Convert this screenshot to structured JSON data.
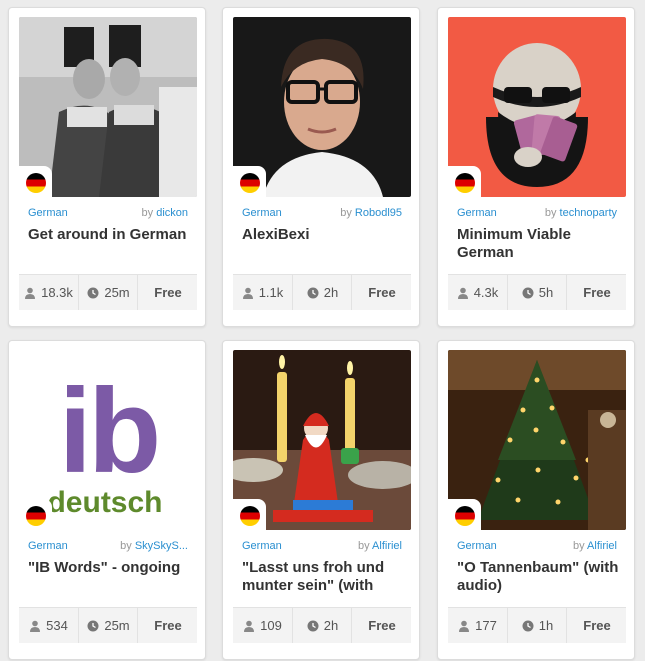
{
  "cards": [
    {
      "language": "German",
      "by_prefix": "by",
      "author": "dickon",
      "title": "Get around in German",
      "learners": "18.3k",
      "duration": "25m",
      "price": "Free",
      "image": "woman-pair-photo"
    },
    {
      "language": "German",
      "by_prefix": "by",
      "author": "Robodl95",
      "title": "AlexiBexi",
      "learners": "1.1k",
      "duration": "2h",
      "price": "Free",
      "image": "man-glasses-photo"
    },
    {
      "language": "German",
      "by_prefix": "by",
      "author": "technoparty",
      "title": "Minimum Viable German",
      "learners": "4.3k",
      "duration": "5h",
      "price": "Free",
      "image": "cartoon-cards-avatar"
    },
    {
      "language": "German",
      "by_prefix": "by",
      "author": "SkySkyS...",
      "title": "\"IB Words\" - ongoing",
      "learners": "534",
      "duration": "25m",
      "price": "Free",
      "image": "ib-deutsch-logo",
      "image_text": [
        "ib",
        "deutsch"
      ]
    },
    {
      "language": "German",
      "by_prefix": "by",
      "author": "Alfiriel",
      "title": "\"Lasst uns froh und munter sein\" (with",
      "learners": "109",
      "duration": "2h",
      "price": "Free",
      "image": "candles-santa-photo"
    },
    {
      "language": "German",
      "by_prefix": "by",
      "author": "Alfiriel",
      "title": "\"O Tannenbaum\" (with audio)",
      "learners": "177",
      "duration": "1h",
      "price": "Free",
      "image": "christmas-tree-photo"
    }
  ],
  "colors": {
    "link": "#2a8fd0",
    "card_bg": "#ffffff",
    "page_bg": "#ececec",
    "cartoon_bg": "#f25a44",
    "ib_purple": "#7c5aa6",
    "ib_green": "#5e8a2c"
  }
}
